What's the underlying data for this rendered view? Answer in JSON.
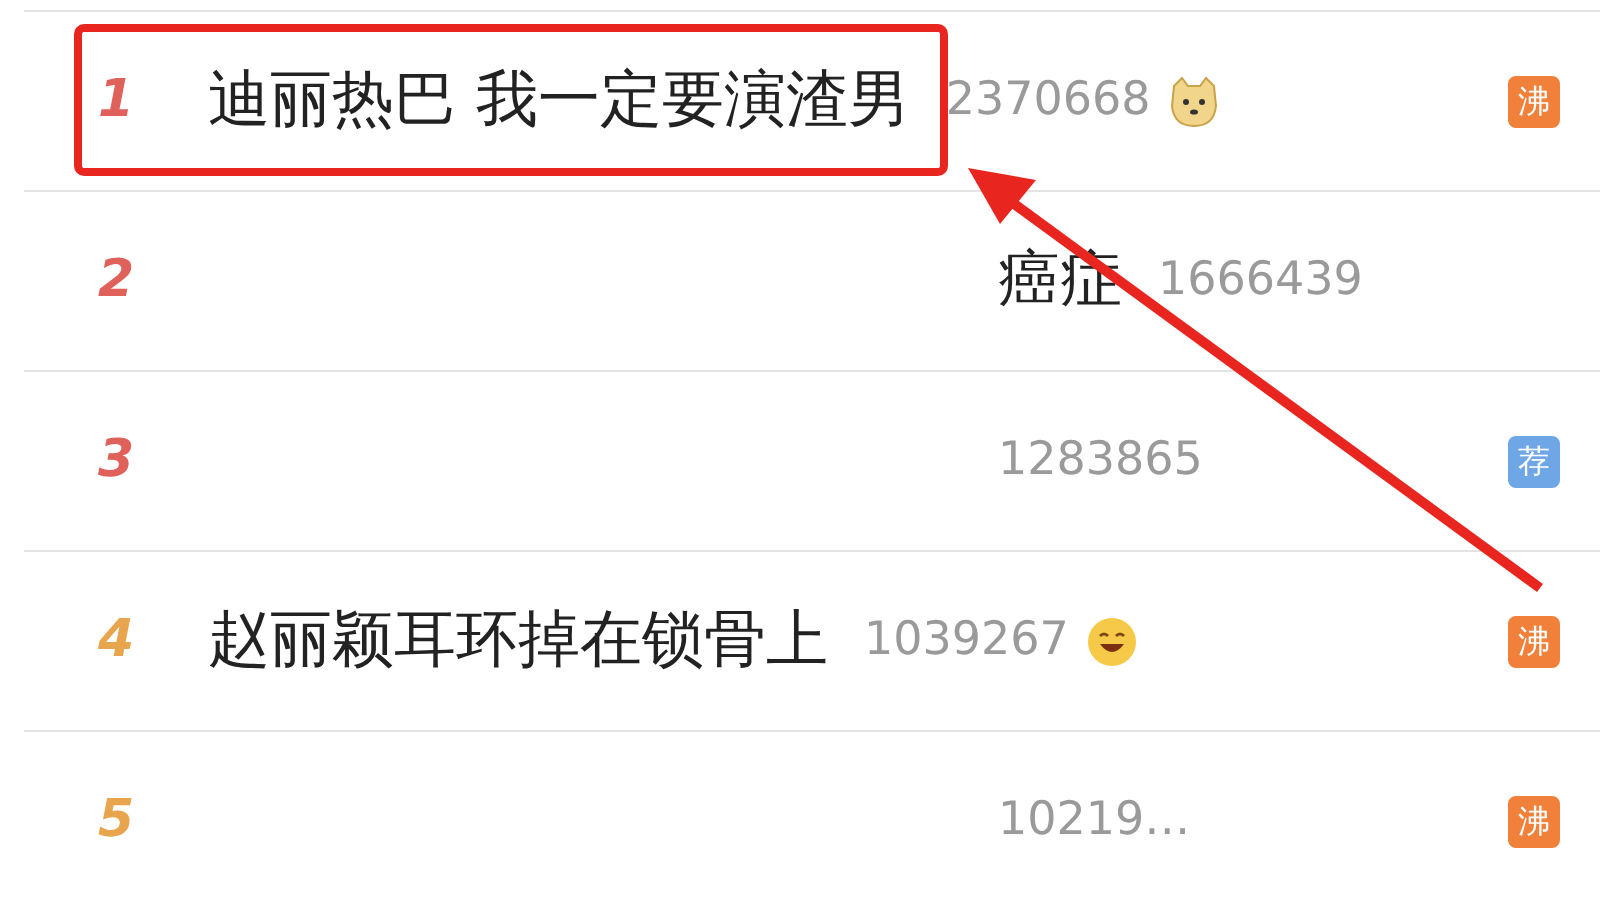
{
  "hot_list": [
    {
      "rank": "1",
      "title": "迪丽热巴 我一定要演渣男",
      "redacted": false,
      "highlighted": true,
      "count": "2370668",
      "emoji": {
        "kind": "dog"
      },
      "badge": {
        "text": "沸",
        "kind": "hot"
      }
    },
    {
      "rank": "2",
      "title": "癌症",
      "redacted": true,
      "highlighted": false,
      "count": "1666439"
    },
    {
      "rank": "3",
      "redacted": true,
      "highlighted": false,
      "count": "1283865",
      "badge": {
        "text": "荐",
        "kind": "recommended"
      }
    },
    {
      "rank": "4",
      "title": "赵丽颖耳环掉在锁骨上",
      "redacted": false,
      "highlighted": false,
      "count": "1039267",
      "emoji": {
        "kind": "grin"
      },
      "badge": {
        "text": "沸",
        "kind": "hot"
      }
    },
    {
      "rank": "5",
      "redacted": true,
      "highlighted": false,
      "count": "10219…",
      "badge": {
        "text": "沸",
        "kind": "hot"
      }
    }
  ]
}
